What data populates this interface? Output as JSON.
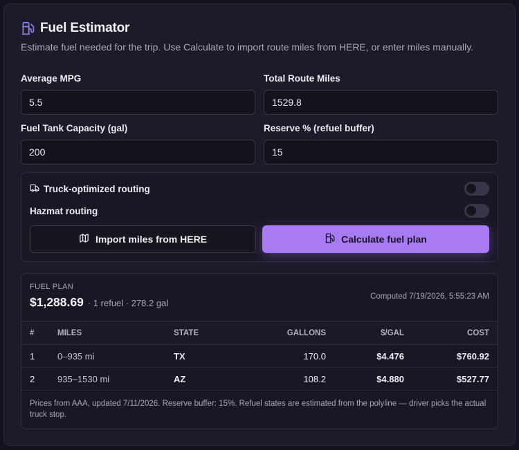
{
  "header": {
    "title": "Fuel Estimator",
    "subtitle": "Estimate fuel needed for the trip. Use Calculate to import route miles from HERE, or enter miles manually."
  },
  "fields": {
    "mpg": {
      "label": "Average MPG",
      "value": "5.5"
    },
    "miles": {
      "label": "Total Route Miles",
      "value": "1529.8"
    },
    "tank": {
      "label": "Fuel Tank Capacity (gal)",
      "value": "200"
    },
    "reserve": {
      "label": "Reserve % (refuel buffer)",
      "value": "15"
    }
  },
  "options": {
    "truck_routing": {
      "label": "Truck-optimized routing",
      "enabled": false
    },
    "hazmat_routing": {
      "label": "Hazmat routing",
      "enabled": false
    }
  },
  "actions": {
    "import_label": "Import miles from HERE",
    "calculate_label": "Calculate fuel plan"
  },
  "plan": {
    "eyebrow": "FUEL PLAN",
    "total": "$1,288.69",
    "meta": "· 1 refuel · 278.2 gal",
    "computed": "Computed 7/19/2026, 5:55:23 AM",
    "columns": [
      "#",
      "MILES",
      "STATE",
      "GALLONS",
      "$/GAL",
      "COST"
    ],
    "rows": [
      {
        "num": "1",
        "miles": "0–935 mi",
        "state": "TX",
        "gallons": "170.0",
        "ppg": "$4.476",
        "cost": "$760.92"
      },
      {
        "num": "2",
        "miles": "935–1530 mi",
        "state": "AZ",
        "gallons": "108.2",
        "ppg": "$4.880",
        "cost": "$527.77"
      }
    ],
    "note": "Prices from AAA, updated 7/11/2026. Reserve buffer: 15%. Refuel states are estimated from the polyline — driver picks the actual truck stop."
  },
  "colors": {
    "accent": "#a87bf5",
    "background": "#1d1a29",
    "icon_accent": "#8b85f0"
  },
  "icons": [
    "fuel-pump-icon",
    "truck-icon",
    "map-icon",
    "fuel-pump-icon"
  ]
}
